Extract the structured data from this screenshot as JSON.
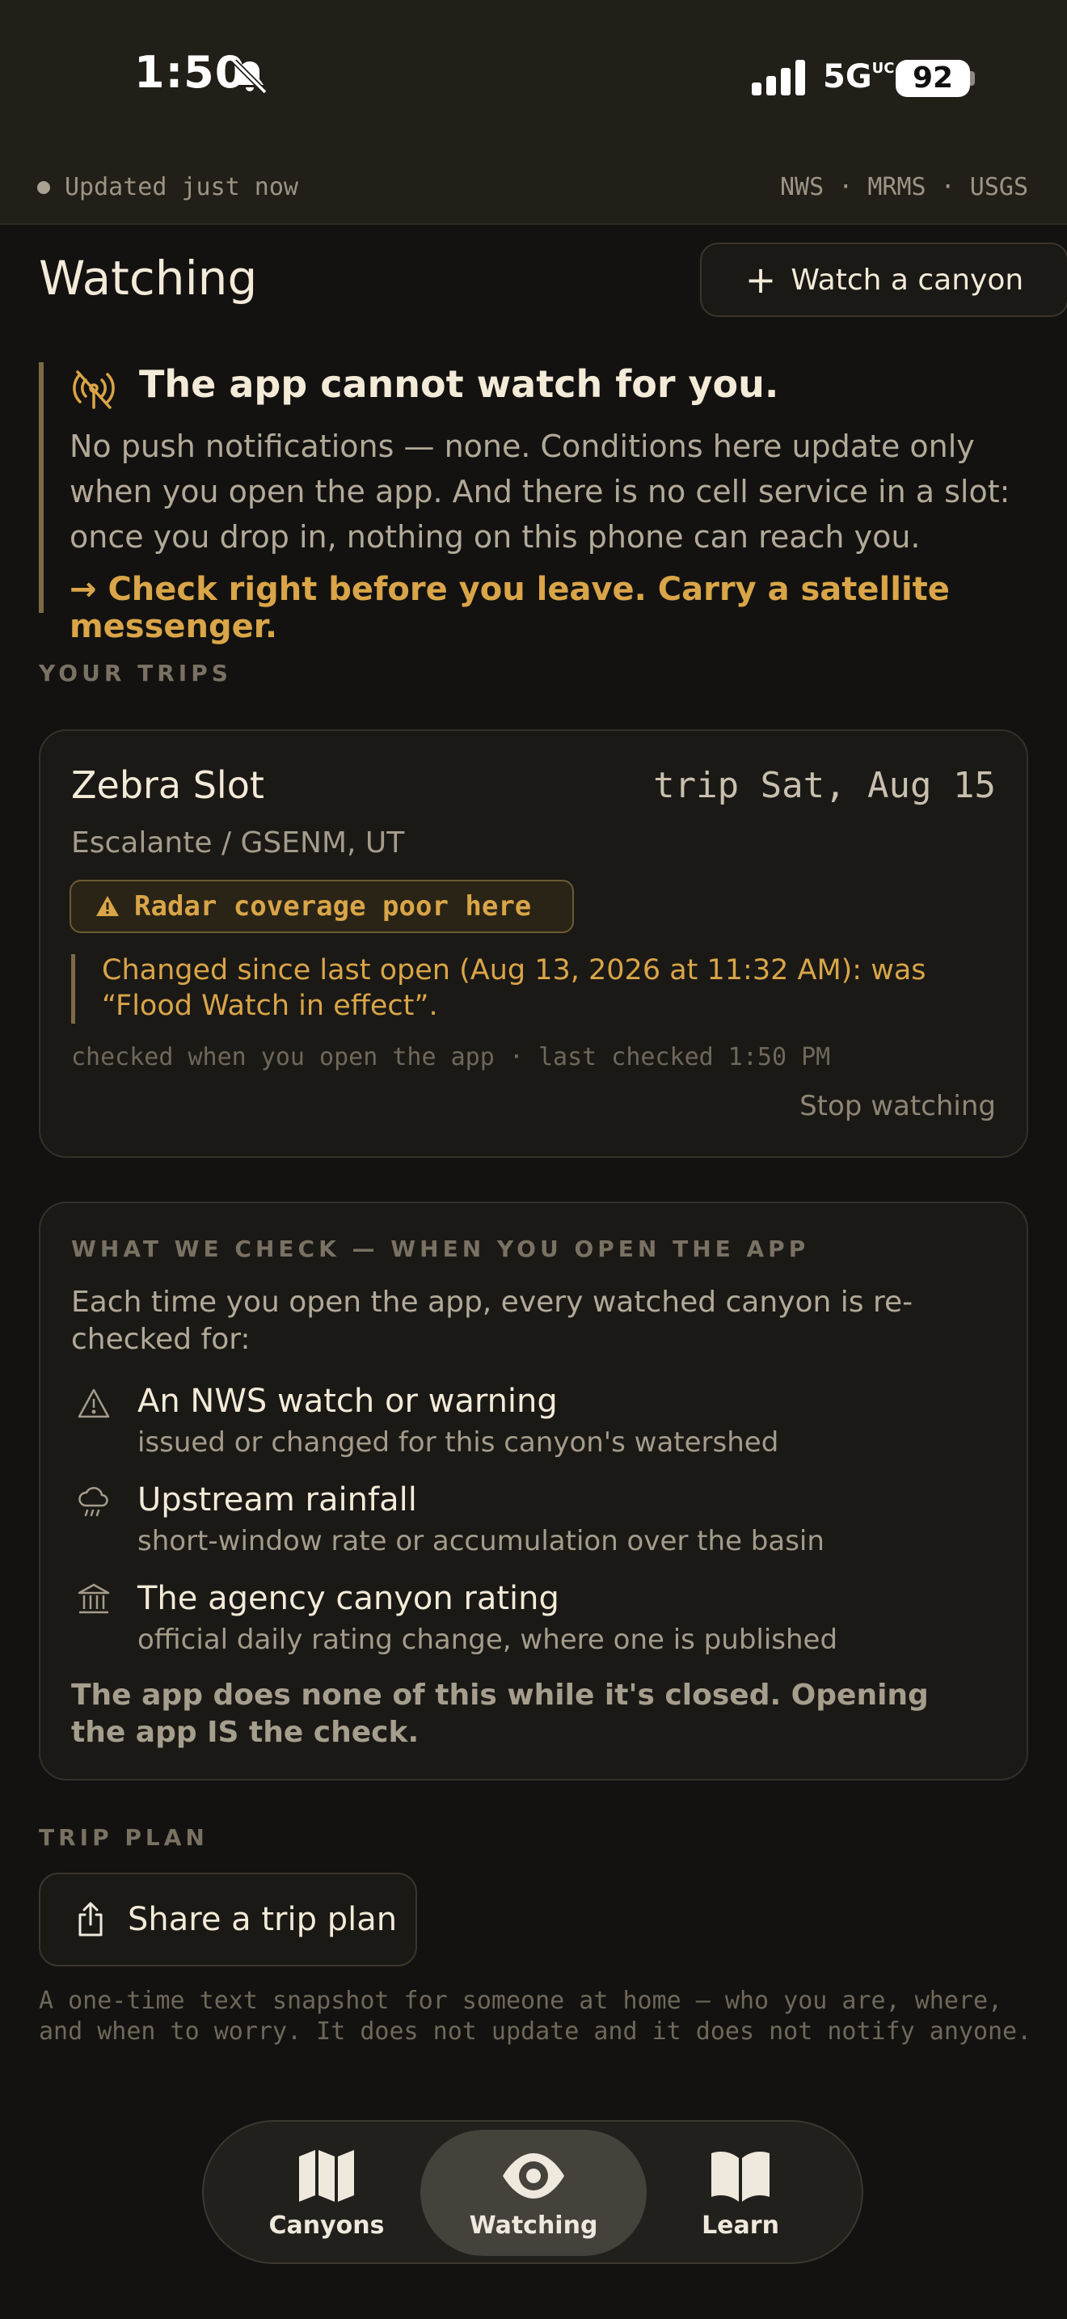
{
  "status_bar": {
    "time": "1:50",
    "network": "5G",
    "network_suffix": "UC",
    "battery": "92"
  },
  "data_status": {
    "updated": "Updated just now",
    "sources": "NWS · MRMS · USGS"
  },
  "header": {
    "title": "Watching",
    "watch_button": "Watch a canyon"
  },
  "warning": {
    "title": "The app cannot watch for you.",
    "body": "No push notifications — none. Conditions here update only when you open the app. And there is no cell service in a slot: once you drop in, nothing on this phone can reach you.",
    "cta": "→ Check right before you leave. Carry a satellite messenger."
  },
  "trips_section": {
    "label": "YOUR TRIPS"
  },
  "trip": {
    "name": "Zebra Slot",
    "date": "trip Sat, Aug 15",
    "location": "Escalante / GSENM, UT",
    "badge": "Radar coverage poor here",
    "changed": "Changed since last open (Aug 13, 2026 at 11:32 AM): was “Flood Watch in effect”.",
    "checked": "checked when you open the app · last checked 1:50 PM",
    "stop": "Stop watching"
  },
  "what_we_check": {
    "label": "WHAT WE CHECK — WHEN YOU OPEN THE APP",
    "intro": "Each time you open the app, every watched canyon is re-checked for:",
    "items": [
      {
        "icon": "warning-triangle-icon",
        "title": "An NWS watch or warning",
        "subtitle": "issued or changed for this canyon's watershed"
      },
      {
        "icon": "rain-cloud-icon",
        "title": "Upstream rainfall",
        "subtitle": "short-window rate or accumulation over the basin"
      },
      {
        "icon": "bank-building-icon",
        "title": "The agency canyon rating",
        "subtitle": "official daily rating change, where one is published"
      }
    ],
    "footer": "The app does none of this while it's closed. Opening the app IS the check."
  },
  "trip_plan": {
    "label": "TRIP PLAN",
    "share_button": "Share a trip plan",
    "note": "A one-time text snapshot for someone at home — who you are, where, and when to worry. It does not update and it does not notify anyone."
  },
  "tabs": [
    {
      "label": "Canyons",
      "icon": "map-icon",
      "active": false
    },
    {
      "label": "Watching",
      "icon": "eye-icon",
      "active": true
    },
    {
      "label": "Learn",
      "icon": "book-icon",
      "active": false
    }
  ],
  "colors": {
    "accent": "#d9a548",
    "background": "#131210",
    "card": "#1b1916",
    "text": "#ede4d3"
  }
}
